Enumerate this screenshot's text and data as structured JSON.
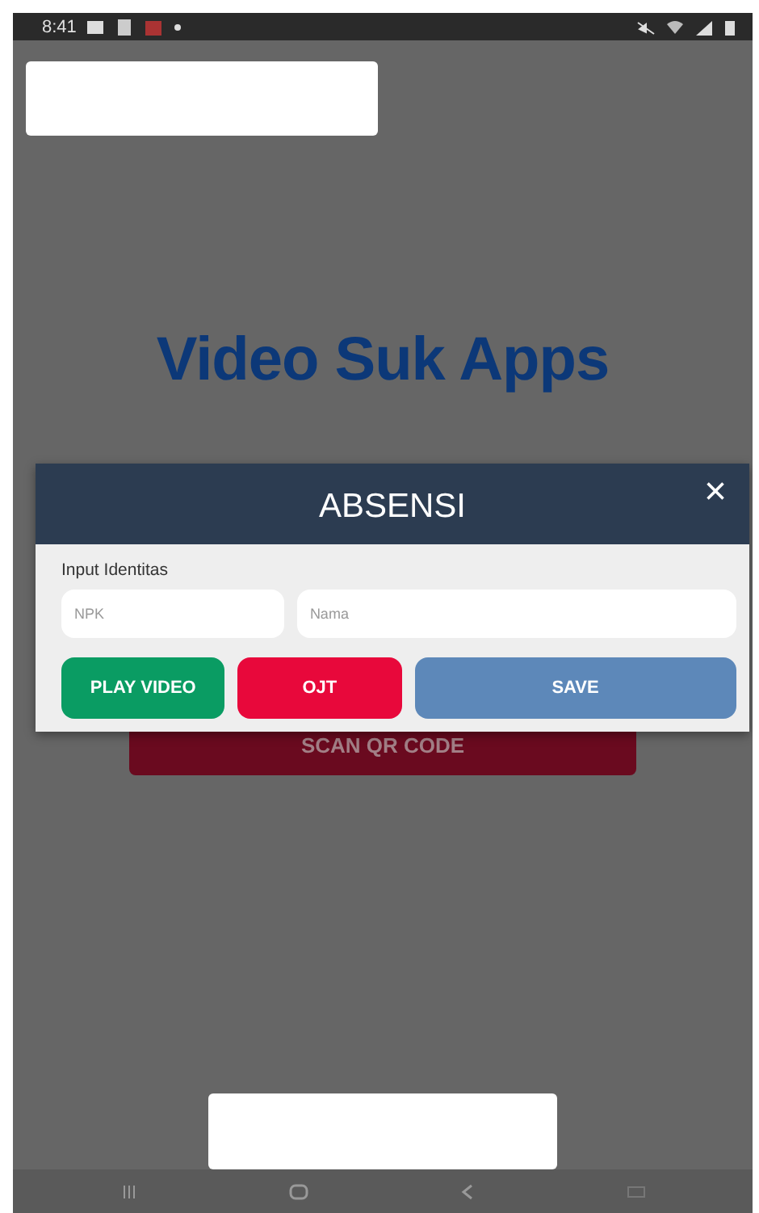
{
  "status_bar": {
    "time": "8:41"
  },
  "app_title": "Video Suk Apps",
  "scan_button": "SCAN QR CODE",
  "dialog": {
    "title": "ABSENSI",
    "close": "×",
    "section_label": "Input Identitas",
    "fields": [
      {
        "placeholder": "NPK"
      },
      {
        "placeholder": "Nama"
      }
    ],
    "buttons": [
      {
        "label": "PLAY VIDEO",
        "color": "#0a9c63"
      },
      {
        "label": "OJT",
        "color": "#e8083b"
      },
      {
        "label": "SAVE",
        "color": "#5d88b9"
      }
    ]
  }
}
